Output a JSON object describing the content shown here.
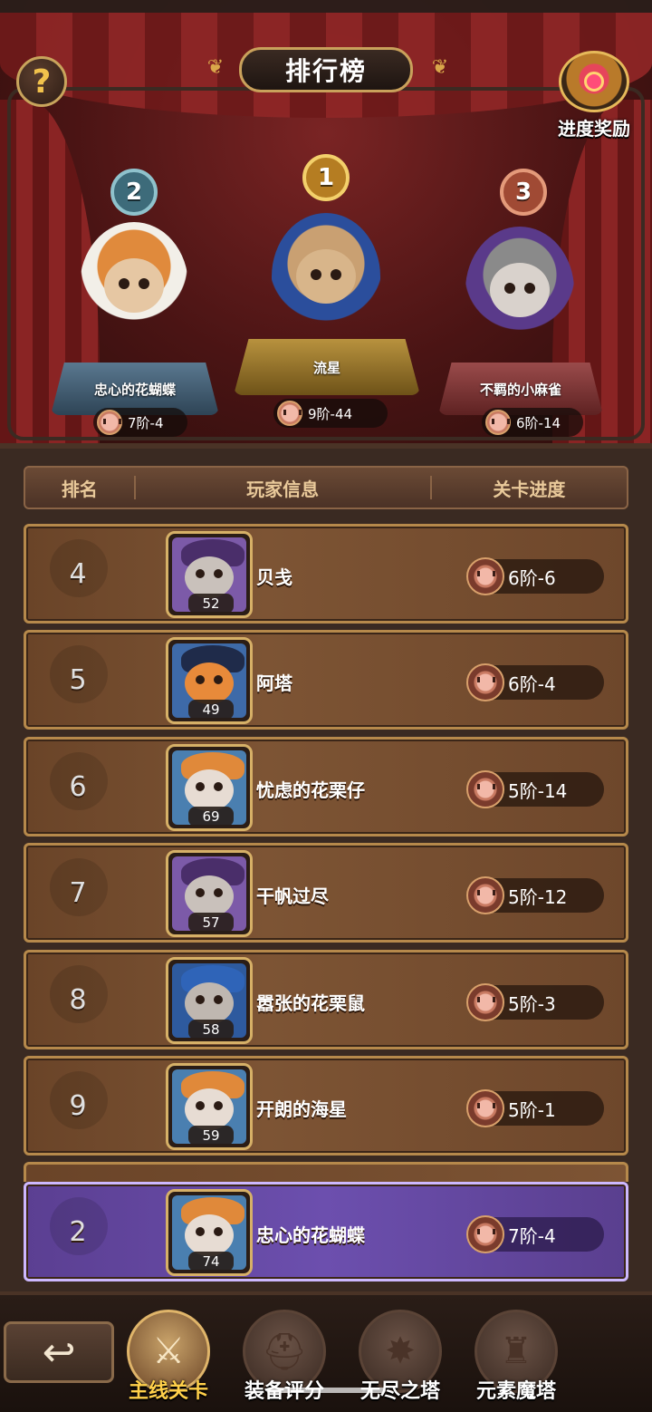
{
  "header": {
    "title": "排行榜",
    "help_label": "?",
    "reward_label": "进度奖励"
  },
  "podium": [
    {
      "rank": "2",
      "name": "忠心的花蝴蝶",
      "progress": "7阶-4",
      "badge_color": "#4f8fa0"
    },
    {
      "rank": "1",
      "name": "流星",
      "progress": "9阶-44",
      "badge_color": "#d6a23a"
    },
    {
      "rank": "3",
      "name": "不羁的小麻雀",
      "progress": "6阶-14",
      "badge_color": "#c46a4a"
    }
  ],
  "table": {
    "col_rank": "排名",
    "col_player": "玩家信息",
    "col_progress": "关卡进度",
    "rows": [
      {
        "rank": "4",
        "name": "贝戋",
        "level": "52",
        "progress": "6阶-6",
        "avatar": "raccoon-purple"
      },
      {
        "rank": "5",
        "name": "阿塔",
        "level": "49",
        "progress": "6阶-4",
        "avatar": "fox-witch"
      },
      {
        "rank": "6",
        "name": "忧虑的花栗仔",
        "level": "69",
        "progress": "5阶-14",
        "avatar": "tiger-hood"
      },
      {
        "rank": "7",
        "name": "干帆过尽",
        "level": "57",
        "progress": "5阶-12",
        "avatar": "raccoon-purple"
      },
      {
        "rank": "8",
        "name": "嚣张的花栗鼠",
        "level": "58",
        "progress": "5阶-3",
        "avatar": "raccoon-blue"
      },
      {
        "rank": "9",
        "name": "开朗的海星",
        "level": "59",
        "progress": "5阶-1",
        "avatar": "tiger-hood"
      }
    ],
    "self_row": {
      "rank": "2",
      "name": "忠心的花蝴蝶",
      "level": "74",
      "progress": "7阶-4",
      "avatar": "tiger-hood"
    }
  },
  "bottom_nav": {
    "back_label": "↩",
    "items": [
      {
        "label": "主线关卡",
        "active": true,
        "icon": "crossed-swords-icon"
      },
      {
        "label": "装备评分",
        "active": false,
        "icon": "helmet-icon"
      },
      {
        "label": "无尽之塔",
        "active": false,
        "icon": "star-emblem-icon"
      },
      {
        "label": "元素魔塔",
        "active": false,
        "icon": "castle-tower-icon"
      }
    ]
  },
  "colors": {
    "row_brown": "#7d5434",
    "row_border": "#b6894b",
    "self_row_purple": "#6c4fae",
    "active_nav_label": "#ffd04a"
  }
}
